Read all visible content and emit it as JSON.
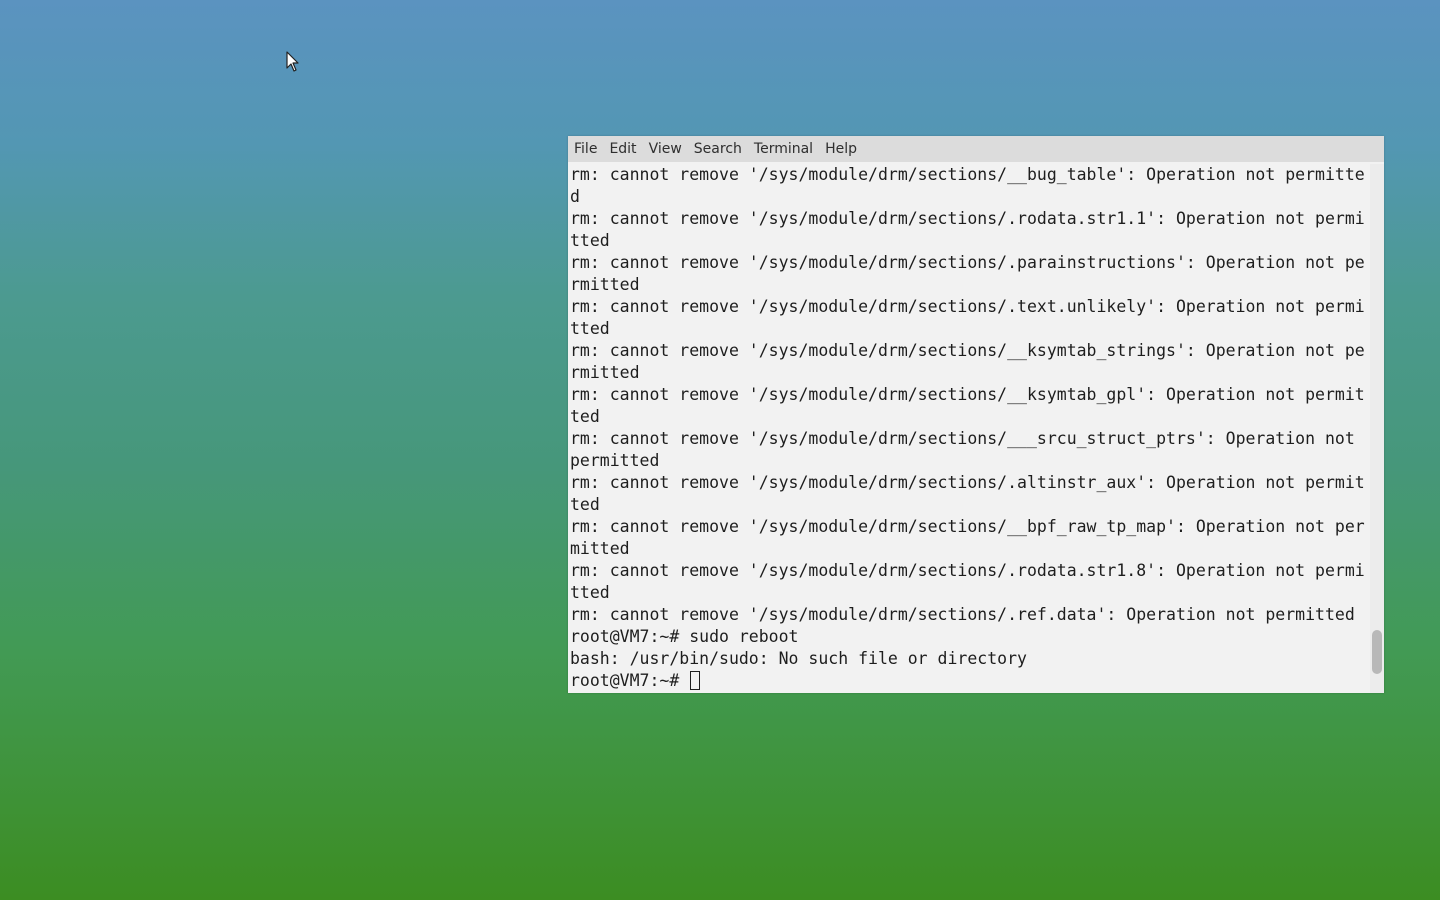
{
  "terminal": {
    "menu": [
      "File",
      "Edit",
      "View",
      "Search",
      "Terminal",
      "Help"
    ],
    "lines": [
      "rm: cannot remove '/sys/module/drm/sections/__bug_table': Operation not permitte",
      "d",
      "rm: cannot remove '/sys/module/drm/sections/.rodata.str1.1': Operation not permi",
      "tted",
      "rm: cannot remove '/sys/module/drm/sections/.parainstructions': Operation not pe",
      "rmitted",
      "rm: cannot remove '/sys/module/drm/sections/.text.unlikely': Operation not permi",
      "tted",
      "rm: cannot remove '/sys/module/drm/sections/__ksymtab_strings': Operation not pe",
      "rmitted",
      "rm: cannot remove '/sys/module/drm/sections/__ksymtab_gpl': Operation not permit",
      "ted",
      "rm: cannot remove '/sys/module/drm/sections/___srcu_struct_ptrs': Operation not ",
      "permitted",
      "rm: cannot remove '/sys/module/drm/sections/.altinstr_aux': Operation not permit",
      "ted",
      "rm: cannot remove '/sys/module/drm/sections/__bpf_raw_tp_map': Operation not per",
      "mitted",
      "rm: cannot remove '/sys/module/drm/sections/.rodata.str1.8': Operation not permi",
      "tted",
      "rm: cannot remove '/sys/module/drm/sections/.ref.data': Operation not permitted",
      "root@VM7:~# sudo reboot",
      "bash: /usr/bin/sudo: No such file or directory"
    ],
    "prompt": "root@VM7:~# "
  },
  "icons": {
    "cursor": "mouse-pointer-icon",
    "caret": "text-cursor-block"
  }
}
